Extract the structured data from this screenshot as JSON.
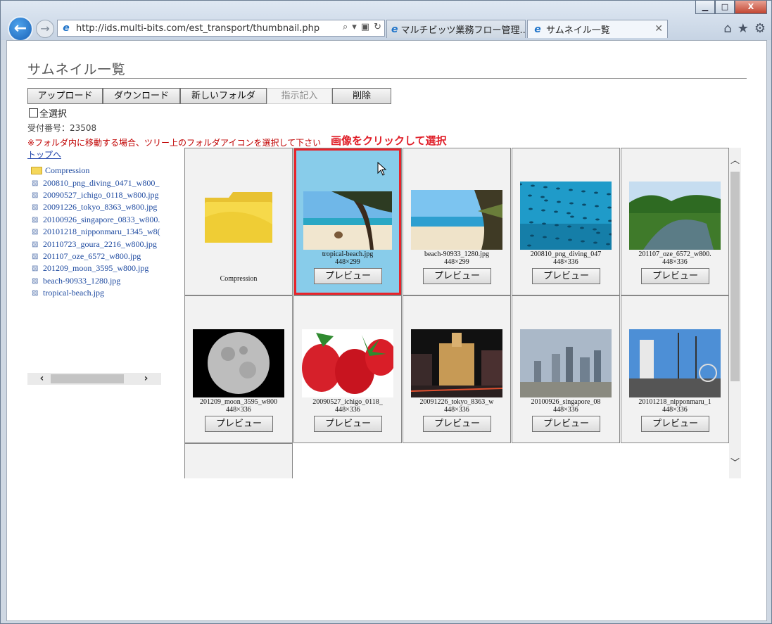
{
  "browser": {
    "url": "http://ids.multi-bits.com/est_transport/thumbnail.php",
    "tabs": [
      {
        "label": "マルチビッツ業務フロー管理..."
      },
      {
        "label": "サムネイル一覧"
      }
    ],
    "window_controls": {
      "minimize": "▁",
      "maximize": "□",
      "close": "X"
    },
    "tool_icons": {
      "home": "⌂",
      "favorites": "★",
      "settings": "⚙"
    }
  },
  "page": {
    "title": "サムネイル一覧",
    "toolbar": {
      "upload": "アップロード",
      "download": "ダウンロード",
      "new_folder": "新しいフォルダ",
      "instructions": "指示記入",
      "delete": "削除"
    },
    "select_all": "全選択",
    "receipt": "受付番号：23508",
    "notice": "※フォルダ内に移動する場合、ツリー上のフォルダアイコンを選択して下さい",
    "callout": "画像をクリックして選択",
    "top_link": "トップへ"
  },
  "tree": [
    {
      "type": "folder",
      "label": "Compression"
    },
    {
      "type": "image",
      "label": "200810_png_diving_0471_w800_"
    },
    {
      "type": "image",
      "label": "20090527_ichigo_0118_w800.jpg"
    },
    {
      "type": "image",
      "label": "20091226_tokyo_8363_w800.jpg"
    },
    {
      "type": "image",
      "label": "20100926_singapore_0833_w800."
    },
    {
      "type": "image",
      "label": "20101218_nipponmaru_1345_w8("
    },
    {
      "type": "image",
      "label": "20110723_goura_2216_w800.jpg"
    },
    {
      "type": "image",
      "label": "201107_oze_6572_w800.jpg"
    },
    {
      "type": "image",
      "label": "201209_moon_3595_w800.jpg"
    },
    {
      "type": "image",
      "label": "beach-90933_1280.jpg"
    },
    {
      "type": "image",
      "label": "tropical-beach.jpg"
    }
  ],
  "thumbnails": [
    {
      "kind": "folder",
      "name": "Compression"
    },
    {
      "kind": "image",
      "name": "tropical-beach.jpg",
      "dims": "448×299",
      "selected": true,
      "preview": "プレビュー",
      "scene": "tropical"
    },
    {
      "kind": "image",
      "name": "beach-90933_1280.jpg",
      "dims": "448×299",
      "preview": "プレビュー",
      "scene": "beach"
    },
    {
      "kind": "image",
      "name": "200810_png_diving_047",
      "dims": "448×336",
      "preview": "プレビュー",
      "scene": "diving"
    },
    {
      "kind": "image",
      "name": "201107_oze_6572_w800.",
      "dims": "448×336",
      "preview": "プレビュー",
      "scene": "oze"
    },
    {
      "kind": "image",
      "name": "201209_moon_3595_w800",
      "dims": "448×336",
      "preview": "プレビュー",
      "scene": "moon"
    },
    {
      "kind": "image",
      "name": "20090527_ichigo_0118_",
      "dims": "448×336",
      "preview": "プレビュー",
      "scene": "strawberry"
    },
    {
      "kind": "image",
      "name": "20091226_tokyo_8363_w",
      "dims": "448×336",
      "preview": "プレビュー",
      "scene": "tokyo"
    },
    {
      "kind": "image",
      "name": "20100926_singapore_08",
      "dims": "448×336",
      "preview": "プレビュー",
      "scene": "singapore"
    },
    {
      "kind": "image",
      "name": "20101218_nipponmaru_1",
      "dims": "448×336",
      "preview": "プレビュー",
      "scene": "ship"
    },
    {
      "kind": "partial",
      "name": "",
      "scene": "partial"
    }
  ]
}
